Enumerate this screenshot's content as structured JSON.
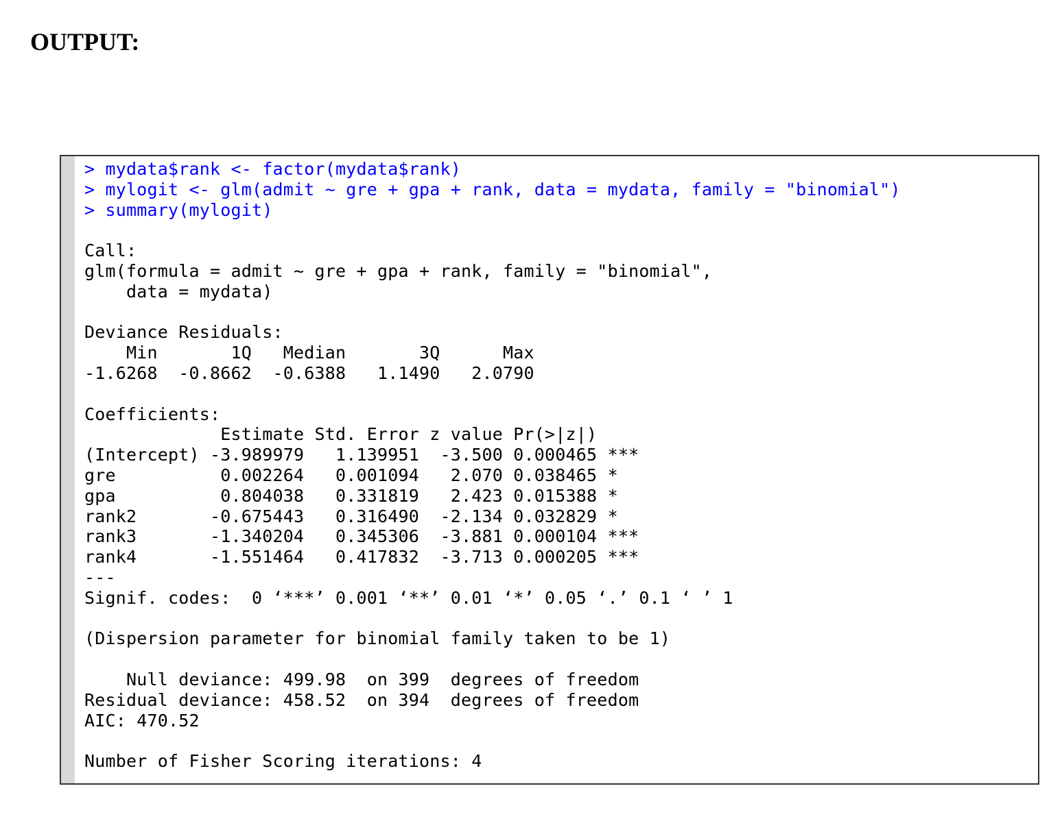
{
  "heading": "OUTPUT:",
  "console": {
    "commands": [
      "> mydata$rank <- factor(mydata$rank)",
      "> mylogit <- glm(admit ~ gre + gpa + rank, data = mydata, family = \"binomial\")",
      "> summary(mylogit)"
    ],
    "output": [
      "",
      "Call:",
      "glm(formula = admit ~ gre + gpa + rank, family = \"binomial\",",
      "    data = mydata)",
      "",
      "Deviance Residuals:",
      "    Min       1Q   Median       3Q      Max",
      "-1.6268  -0.8662  -0.6388   1.1490   2.0790",
      "",
      "Coefficients:",
      "             Estimate Std. Error z value Pr(>|z|)",
      "(Intercept) -3.989979   1.139951  -3.500 0.000465 ***",
      "gre          0.002264   0.001094   2.070 0.038465 *",
      "gpa          0.804038   0.331819   2.423 0.015388 *",
      "rank2       -0.675443   0.316490  -2.134 0.032829 *",
      "rank3       -1.340204   0.345306  -3.881 0.000104 ***",
      "rank4       -1.551464   0.417832  -3.713 0.000205 ***",
      "---",
      "Signif. codes:  0 ‘***’ 0.001 ‘**’ 0.01 ‘*’ 0.05 ‘.’ 0.1 ‘ ’ 1",
      "",
      "(Dispersion parameter for binomial family taken to be 1)",
      "",
      "    Null deviance: 499.98  on 399  degrees of freedom",
      "Residual deviance: 458.52  on 394  degrees of freedom",
      "AIC: 470.52",
      "",
      "Number of Fisher Scoring iterations: 4"
    ]
  },
  "colors": {
    "command": "#0000ff",
    "output": "#000000",
    "gutter": "#d8d8d8",
    "border": "#333333"
  }
}
